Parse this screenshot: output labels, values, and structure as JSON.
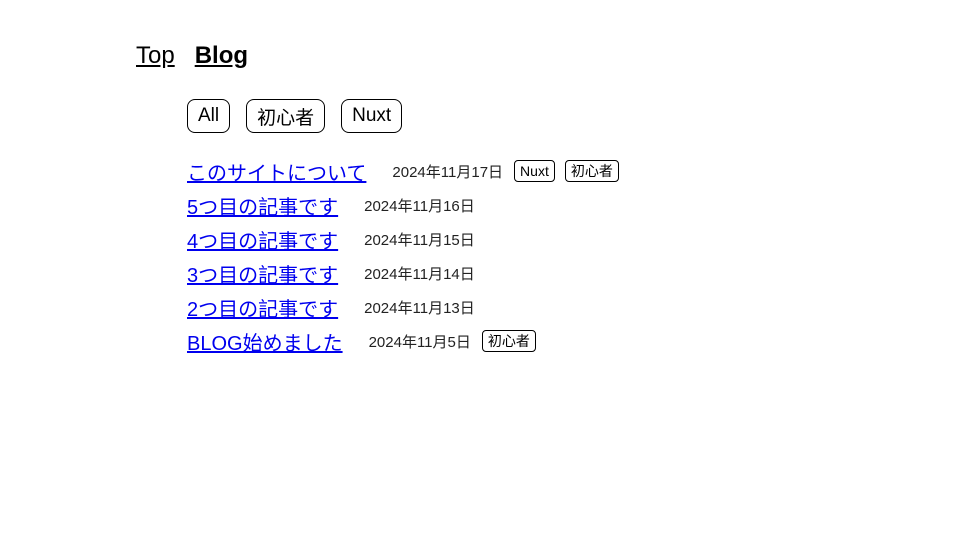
{
  "nav": {
    "items": [
      {
        "label": "Top",
        "active": false
      },
      {
        "label": "Blog",
        "active": true
      }
    ]
  },
  "filters": [
    "All",
    "初心者",
    "Nuxt"
  ],
  "posts": [
    {
      "title": "このサイトについて",
      "date": "2024年11月17日",
      "tags": [
        "Nuxt",
        "初心者"
      ]
    },
    {
      "title": "5つ目の記事です",
      "date": "2024年11月16日",
      "tags": []
    },
    {
      "title": "4つ目の記事です",
      "date": "2024年11月15日",
      "tags": []
    },
    {
      "title": "3つ目の記事です",
      "date": "2024年11月14日",
      "tags": []
    },
    {
      "title": "2つ目の記事です",
      "date": "2024年11月13日",
      "tags": []
    },
    {
      "title": "BLOG始めました",
      "date": "2024年11月5日",
      "tags": [
        "初心者"
      ]
    }
  ],
  "colors": {
    "link": "#0000ee",
    "text": "#000000"
  }
}
